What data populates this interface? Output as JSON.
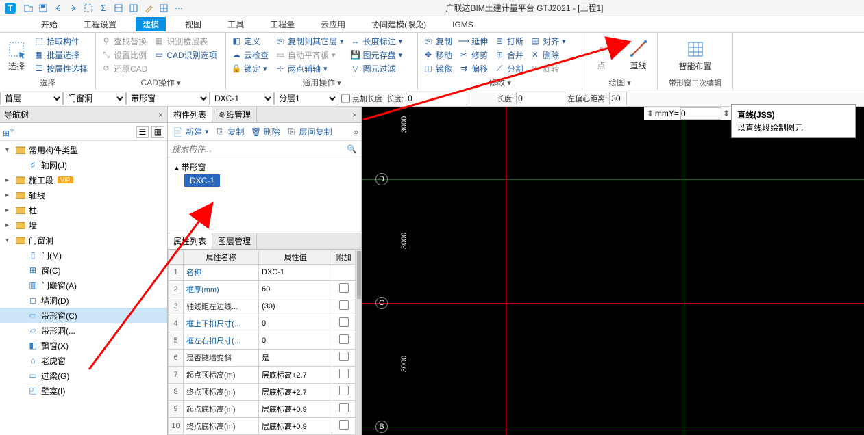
{
  "title": "广联达BIM土建计量平台 GTJ2021 - [工程1]",
  "menubar": [
    "开始",
    "工程设置",
    "建模",
    "视图",
    "工具",
    "工程量",
    "云应用",
    "协同建模(限免)",
    "IGMS"
  ],
  "menubar_active": 2,
  "ribbon": {
    "g_select": {
      "big": "选择",
      "items": [
        "拾取构件",
        "批量选择",
        "按属性选择"
      ],
      "label": "选择"
    },
    "g_cad": {
      "items": [
        [
          "查找替换",
          "识别楼层表"
        ],
        [
          "设置比例",
          "CAD识别选项"
        ],
        [
          "还原CAD",
          ""
        ]
      ],
      "label": "CAD操作"
    },
    "g_general": {
      "items": [
        [
          "定义",
          "复制到其它层",
          "长度标注"
        ],
        [
          "云检查",
          "自动平齐板",
          "图元存盘"
        ],
        [
          "锁定",
          "两点辅轴",
          "图元过滤"
        ]
      ],
      "label": "通用操作"
    },
    "g_modify": {
      "items": [
        [
          "复制",
          "延伸",
          "打断",
          "对齐"
        ],
        [
          "移动",
          "修剪",
          "合并",
          "删除"
        ],
        [
          "镜像",
          "偏移",
          "分割",
          "旋转"
        ]
      ],
      "label": "修改"
    },
    "g_draw": {
      "items": [
        "点",
        "直线"
      ],
      "label": "绘图"
    },
    "g_smart": {
      "big": "智能布置",
      "label": "带形窗二次编辑"
    }
  },
  "filter": {
    "floor": "首层",
    "category": "门窗洞",
    "type": "带形窗",
    "component": "DXC-1",
    "layer": "分层1",
    "chk_label": "点加长度",
    "len_label": "长度:",
    "len_val": "0",
    "rev_label": "长度:",
    "rev_val": "0",
    "left_label": "左偏心距离:",
    "left_val": "30"
  },
  "coord": {
    "y_label": "mmY=",
    "y_val": "0",
    "mm": "mm"
  },
  "tooltip": {
    "title": "直线(JSS)",
    "desc": "以直线段绘制图元"
  },
  "nav": {
    "title": "导航树",
    "root": "常用构件类型",
    "axis_net": "轴网(J)",
    "stage": "施工段",
    "axis_line": "轴线",
    "column": "柱",
    "wall": "墙",
    "door_hole": "门窗洞",
    "door": "门(M)",
    "window": "窗(C)",
    "gate_window": "门联窗(A)",
    "wall_hole": "墙洞(D)",
    "band_window": "带形窗(C)",
    "band_hole": "带形洞(...",
    "bay": "飘窗(X)",
    "tiger": "老虎窗",
    "lintel": "过梁(G)",
    "niche": "壁龛(I)"
  },
  "comp": {
    "tab_list": "构件列表",
    "tab_drawing": "图纸管理",
    "btn_new": "新建",
    "btn_copy": "复制",
    "btn_del": "删除",
    "btn_floor_copy": "层间复制",
    "search_ph": "搜索构件...",
    "group": "带形窗",
    "item": "DXC-1"
  },
  "prop": {
    "tab_prop": "属性列表",
    "tab_layer": "图层管理",
    "hdr_name": "属性名称",
    "hdr_val": "属性值",
    "hdr_add": "附加",
    "rows": [
      {
        "n": "1",
        "name": "名称",
        "val": "DXC-1",
        "blue": true,
        "cb": false
      },
      {
        "n": "2",
        "name": "框厚(mm)",
        "val": "60",
        "blue": true,
        "cb": true
      },
      {
        "n": "3",
        "name": "轴线距左边线...",
        "val": "(30)",
        "blue": false,
        "cb": true
      },
      {
        "n": "4",
        "name": "框上下扣尺寸(...",
        "val": "0",
        "blue": true,
        "cb": true
      },
      {
        "n": "5",
        "name": "框左右扣尺寸(...",
        "val": "0",
        "blue": true,
        "cb": true
      },
      {
        "n": "6",
        "name": "是否随墙变斜",
        "val": "是",
        "blue": false,
        "cb": true
      },
      {
        "n": "7",
        "name": "起点顶标高(m)",
        "val": "层底标高+2.7",
        "blue": false,
        "cb": true
      },
      {
        "n": "8",
        "name": "终点顶标高(m)",
        "val": "层底标高+2.7",
        "blue": false,
        "cb": true
      },
      {
        "n": "9",
        "name": "起点底标高(m)",
        "val": "层底标高+0.9",
        "blue": false,
        "cb": true
      },
      {
        "n": "10",
        "name": "终点底标高(m)",
        "val": "层底标高+0.9",
        "blue": false,
        "cb": true
      }
    ]
  },
  "canvas": {
    "axis": [
      "D",
      "C",
      "B"
    ],
    "dim": "3000"
  }
}
